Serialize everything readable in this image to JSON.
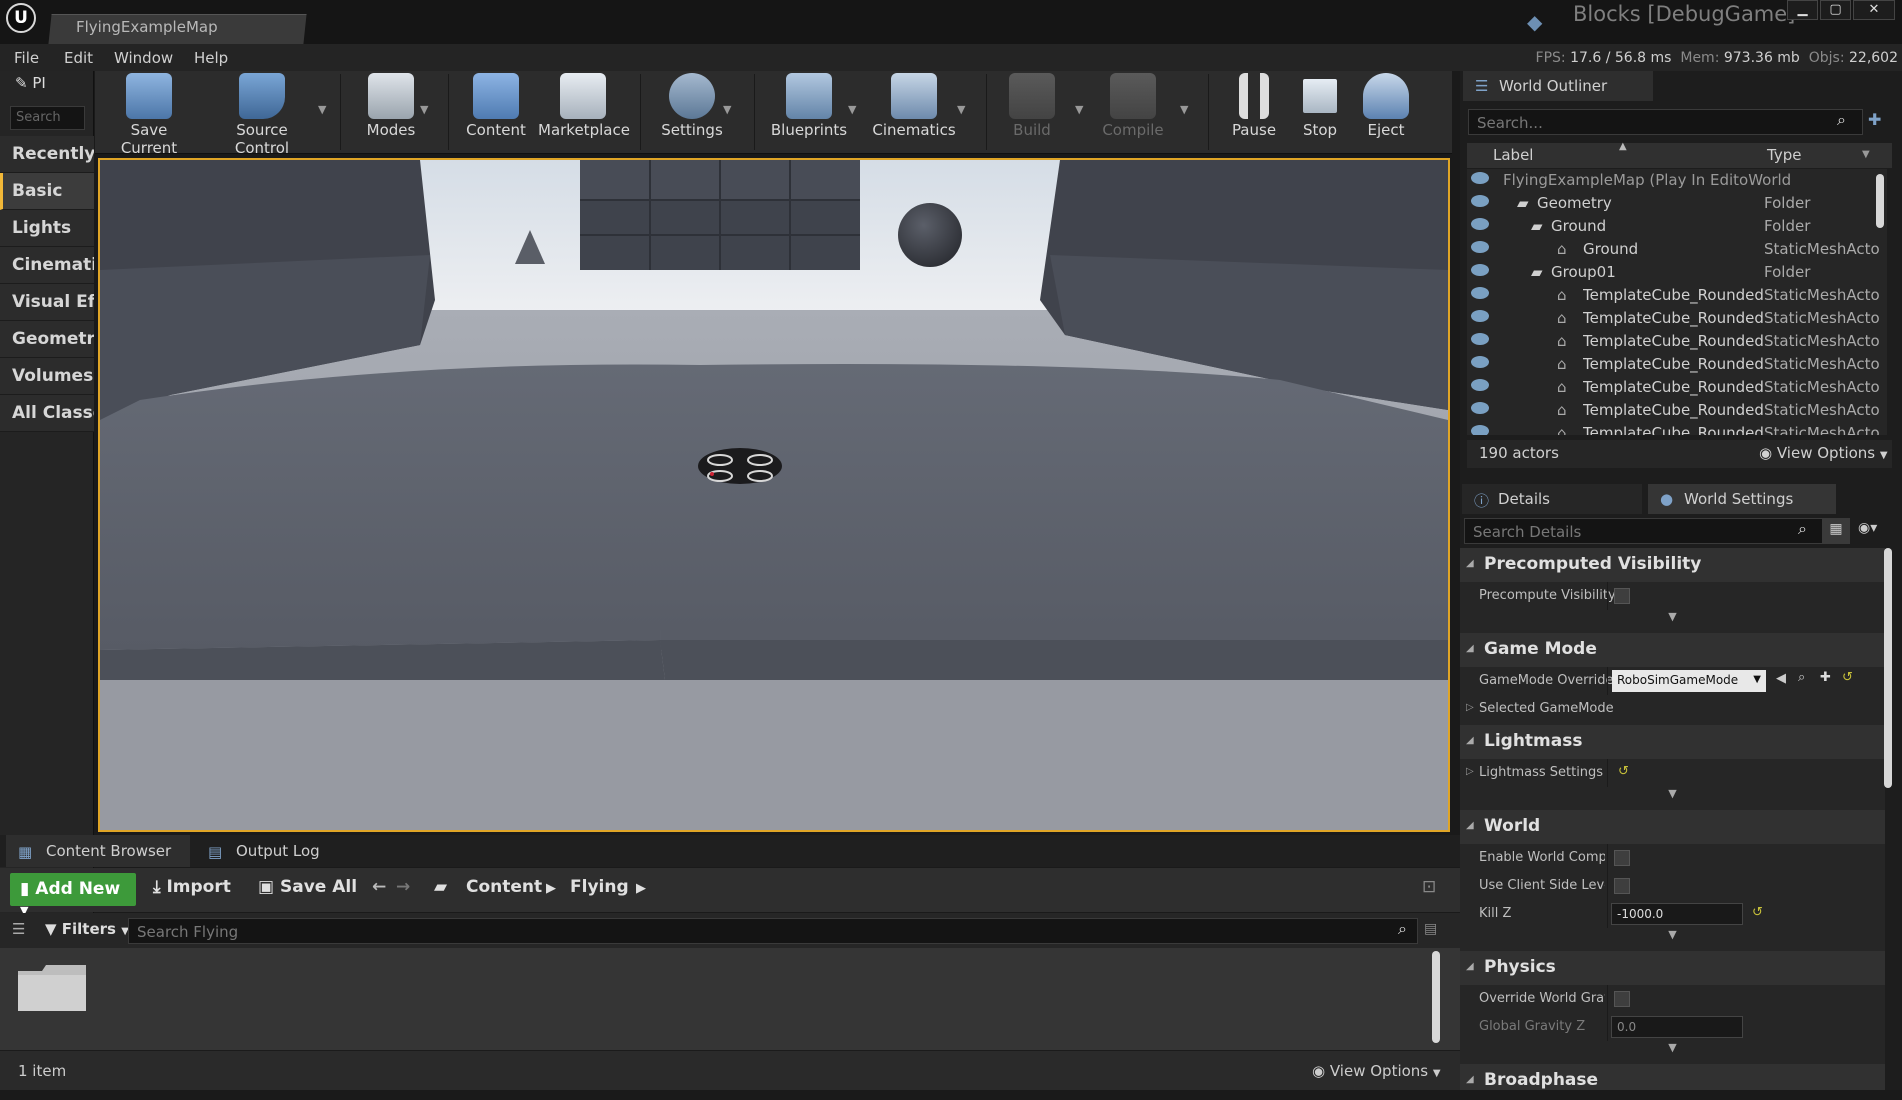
{
  "window": {
    "doc_tab": "FlyingExampleMap",
    "project_title": "Blocks [DebugGame]",
    "min": "▁",
    "max": "▢",
    "close": "✕"
  },
  "menu": [
    "File",
    "Edit",
    "Window",
    "Help"
  ],
  "stats": {
    "fps_label": "FPS:",
    "fps": "17.6",
    "ms": "/ 56.8 ms",
    "mem_label": "Mem:",
    "mem": "973.36 mb",
    "objs_label": "Objs:",
    "objs": "22,602"
  },
  "modes_panel": {
    "pi_label": "PI",
    "search_placeholder": "Search",
    "categories": [
      "Recently Placed",
      "Basic",
      "Lights",
      "Cinematic",
      "Visual Effects",
      "Geometry",
      "Volumes",
      "All Classes"
    ]
  },
  "toolbar": {
    "save": "Save Current",
    "source_control": "Source Control",
    "modes": "Modes",
    "content": "Content",
    "marketplace": "Marketplace",
    "settings": "Settings",
    "blueprints": "Blueprints",
    "cinematics": "Cinematics",
    "build": "Build",
    "compile": "Compile",
    "pause": "Pause",
    "stop": "Stop",
    "eject": "Eject"
  },
  "content_browser": {
    "tab_content": "Content Browser",
    "tab_output": "Output Log",
    "add_new": "Add New",
    "import": "Import",
    "save_all": "Save All",
    "path_content": "Content",
    "path_flying": "Flying",
    "filters": "Filters",
    "search_placeholder": "Search Flying",
    "item_count": "1 item",
    "view_options": "View Options"
  },
  "world_outliner": {
    "tab": "World Outliner",
    "search_placeholder": "Search...",
    "col_label": "Label",
    "col_type": "Type",
    "rows": [
      {
        "label": "FlyingExampleMap (Play In EditoWorld",
        "type": ""
      },
      {
        "label": "Geometry",
        "type": "Folder"
      },
      {
        "label": "Ground",
        "type": "Folder"
      },
      {
        "label": "Ground",
        "type": "StaticMeshActo"
      },
      {
        "label": "Group01",
        "type": "Folder"
      },
      {
        "label": "TemplateCube_Rounded_",
        "type": "StaticMeshActo"
      },
      {
        "label": "TemplateCube_Rounded_",
        "type": "StaticMeshActo"
      },
      {
        "label": "TemplateCube_Rounded_",
        "type": "StaticMeshActo"
      },
      {
        "label": "TemplateCube_Rounded_",
        "type": "StaticMeshActo"
      },
      {
        "label": "TemplateCube_Rounded_",
        "type": "StaticMeshActo"
      },
      {
        "label": "TemplateCube_Rounded_",
        "type": "StaticMeshActo"
      },
      {
        "label": "TemplateCube_Rounded_",
        "type": "StaticMeshActo"
      }
    ],
    "actor_count": "190 actors",
    "view_options": "View Options"
  },
  "details": {
    "tab_details": "Details",
    "tab_world_settings": "World Settings",
    "search_placeholder": "Search Details",
    "sections": {
      "precomputed": "Precomputed Visibility",
      "game_mode": "Game Mode",
      "lightmass": "Lightmass",
      "world": "World",
      "physics": "Physics",
      "broadphase": "Broadphase"
    },
    "props": {
      "precompute_visibility": "Precompute Visibility",
      "gamemode_override": "GameMode Override",
      "gamemode_value": "RoboSimGameMode",
      "selected_gamemode": "Selected GameMode",
      "lightmass_settings": "Lightmass Settings",
      "enable_world_comp": "Enable World Composi",
      "use_client_side": "Use Client Side Level S",
      "kill_z": "Kill Z",
      "kill_z_value": "-1000.0",
      "override_gravity": "Override World Gravity",
      "global_gravity": "Global Gravity Z",
      "global_gravity_value": "0.0"
    }
  }
}
